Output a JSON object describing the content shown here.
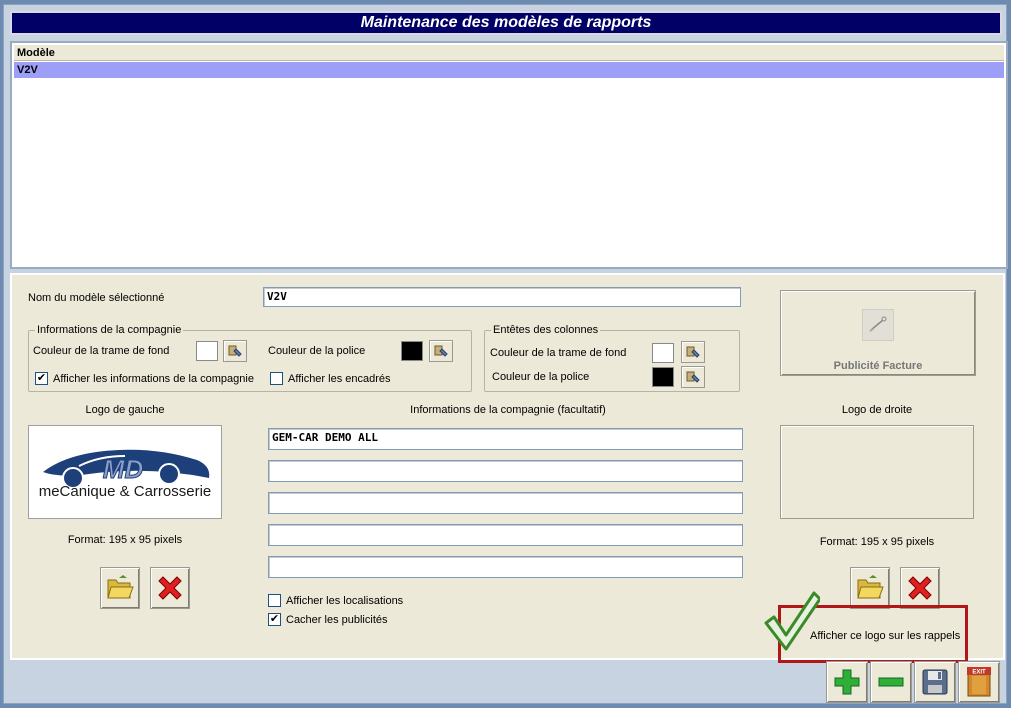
{
  "window": {
    "title": "Maintenance des modèles de rapports"
  },
  "list": {
    "header": "Modèle",
    "rows": [
      "V2V"
    ]
  },
  "form": {
    "model_name_label": "Nom du modèle sélectionné",
    "model_name_value": "V2V",
    "company_group": {
      "title": "Informations de la compagnie",
      "bg_color_label": "Couleur de la trame de fond",
      "font_color_label": "Couleur de la police",
      "show_info_label": "Afficher les informations de la compagnie",
      "show_info_checked": true,
      "show_frames_label": "Afficher les encadrés",
      "show_frames_checked": false,
      "bg_color": "#ffffff",
      "font_color": "#000000"
    },
    "columns_group": {
      "title": "Entêtes des colonnes",
      "bg_color_label": "Couleur de la trame de fond",
      "font_color_label": "Couleur de la police",
      "bg_color": "#ffffff",
      "font_color": "#000000"
    },
    "pub_button_label": "Publicité Facture",
    "left_logo": {
      "title": "Logo de gauche",
      "format": "Format: 195 x 95 pixels",
      "logo_main": "MD",
      "logo_sub": "meCanique & Carrosserie"
    },
    "right_logo": {
      "title": "Logo de droite",
      "format": "Format: 195 x 95 pixels"
    },
    "company_info": {
      "title": "Informations de la compagnie (facultatif)",
      "lines": [
        "GEM-CAR DEMO ALL",
        "",
        "",
        "",
        ""
      ]
    },
    "show_locations_label": "Afficher les localisations",
    "show_locations_checked": false,
    "hide_ads_label": "Cacher les publicités",
    "hide_ads_checked": true,
    "show_logo_reminders_label": "Afficher ce logo sur les rappels",
    "show_logo_reminders_checked": true,
    "exit_label": "EXIT"
  },
  "colors": {
    "title_bg": "#000066",
    "selected_row": "#9d9ef5",
    "panel_bg": "#ece9d8",
    "highlight_box": "#b01818"
  },
  "icons": {
    "open_folder": "folder-open-icon",
    "delete": "red-x-icon",
    "add": "green-plus-icon",
    "remove": "green-minus-icon",
    "save": "floppy-disk-icon",
    "exit": "exit-door-icon",
    "color_picker": "paint-dropper-icon"
  }
}
